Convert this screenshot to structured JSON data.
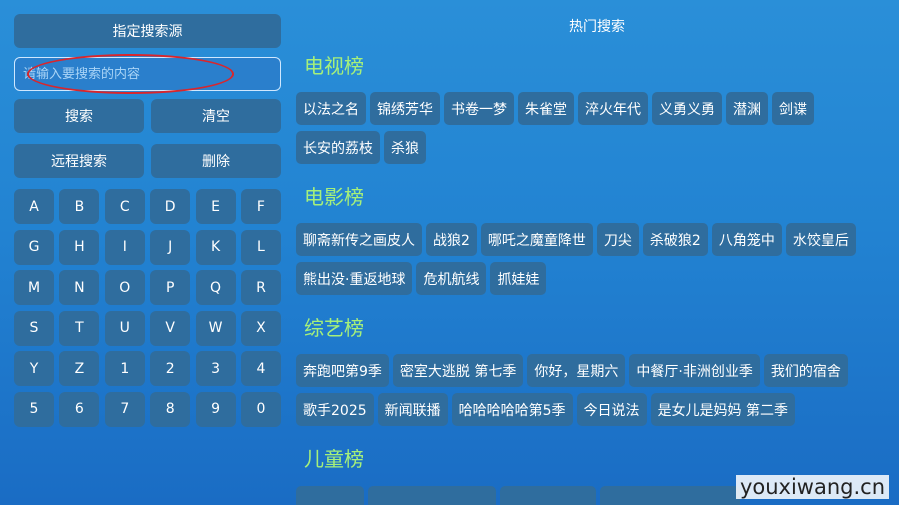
{
  "left_panel": {
    "source_button": "指定搜索源",
    "search_placeholder": "请输入要搜索的内容",
    "search_value": "",
    "search_button": "搜索",
    "clear_button": "清空",
    "remote_search_button": "远程搜索",
    "delete_button": "删除",
    "keys": [
      "A",
      "B",
      "C",
      "D",
      "E",
      "F",
      "G",
      "H",
      "I",
      "J",
      "K",
      "L",
      "M",
      "N",
      "O",
      "P",
      "Q",
      "R",
      "S",
      "T",
      "U",
      "V",
      "W",
      "X",
      "Y",
      "Z",
      "1",
      "2",
      "3",
      "4",
      "5",
      "6",
      "7",
      "8",
      "9",
      "0"
    ]
  },
  "right_panel": {
    "title": "热门搜索",
    "sections": [
      {
        "title": "电视榜",
        "items": [
          "以法之名",
          "锦绣芳华",
          "书卷一梦",
          "朱雀堂",
          "淬火年代",
          "义勇义勇",
          "潜渊",
          "剑谍",
          "长安的荔枝",
          "杀狼"
        ]
      },
      {
        "title": "电影榜",
        "items": [
          "聊斋新传之画皮人",
          "战狼2",
          "哪吒之魔童降世",
          "刀尖",
          "杀破狼2",
          "八角笼中",
          "水饺皇后",
          "熊出没·重返地球",
          "危机航线",
          "抓娃娃"
        ]
      },
      {
        "title": "综艺榜",
        "items": [
          "奔跑吧第9季",
          "密室大逃脱 第七季",
          "你好，星期六",
          "中餐厅·非洲创业季",
          "我们的宿舍",
          "歌手2025",
          "新闻联播",
          "哈哈哈哈哈第5季",
          "今日说法",
          "是女儿是妈妈 第二季"
        ]
      },
      {
        "title": "儿童榜",
        "items": []
      }
    ]
  },
  "watermark": "youxiwang.cn",
  "annotation_color": "#d9262c"
}
